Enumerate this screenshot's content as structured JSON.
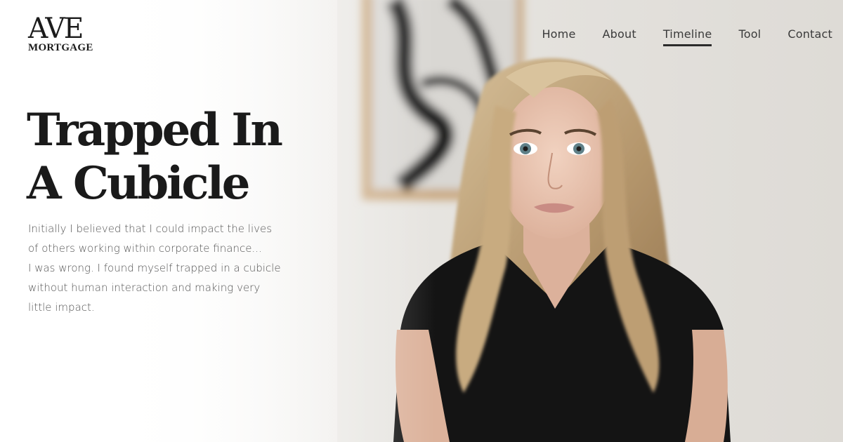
{
  "brand": {
    "logo_main": "AVE",
    "logo_sub": "MORTGAGE"
  },
  "nav": {
    "items": [
      {
        "label": "Home",
        "active": false
      },
      {
        "label": "About",
        "active": false
      },
      {
        "label": "Timeline",
        "active": true
      },
      {
        "label": "Tool",
        "active": false
      },
      {
        "label": "Contact",
        "active": false
      }
    ]
  },
  "hero": {
    "headline_line1": "Trapped In",
    "headline_line2": "A Cubicle",
    "body_lines": [
      "Initially I believed that I could impact the lives",
      "of others working within corporate finance...",
      "I was wrong. I found myself trapped in a cubicle",
      "without human interaction and making very",
      "little impact."
    ]
  },
  "colors": {
    "text_dark": "#1a1a1a",
    "text_body": "#555555",
    "nav_text": "#3a3a3a",
    "accent_underline": "#2b2b2b"
  }
}
